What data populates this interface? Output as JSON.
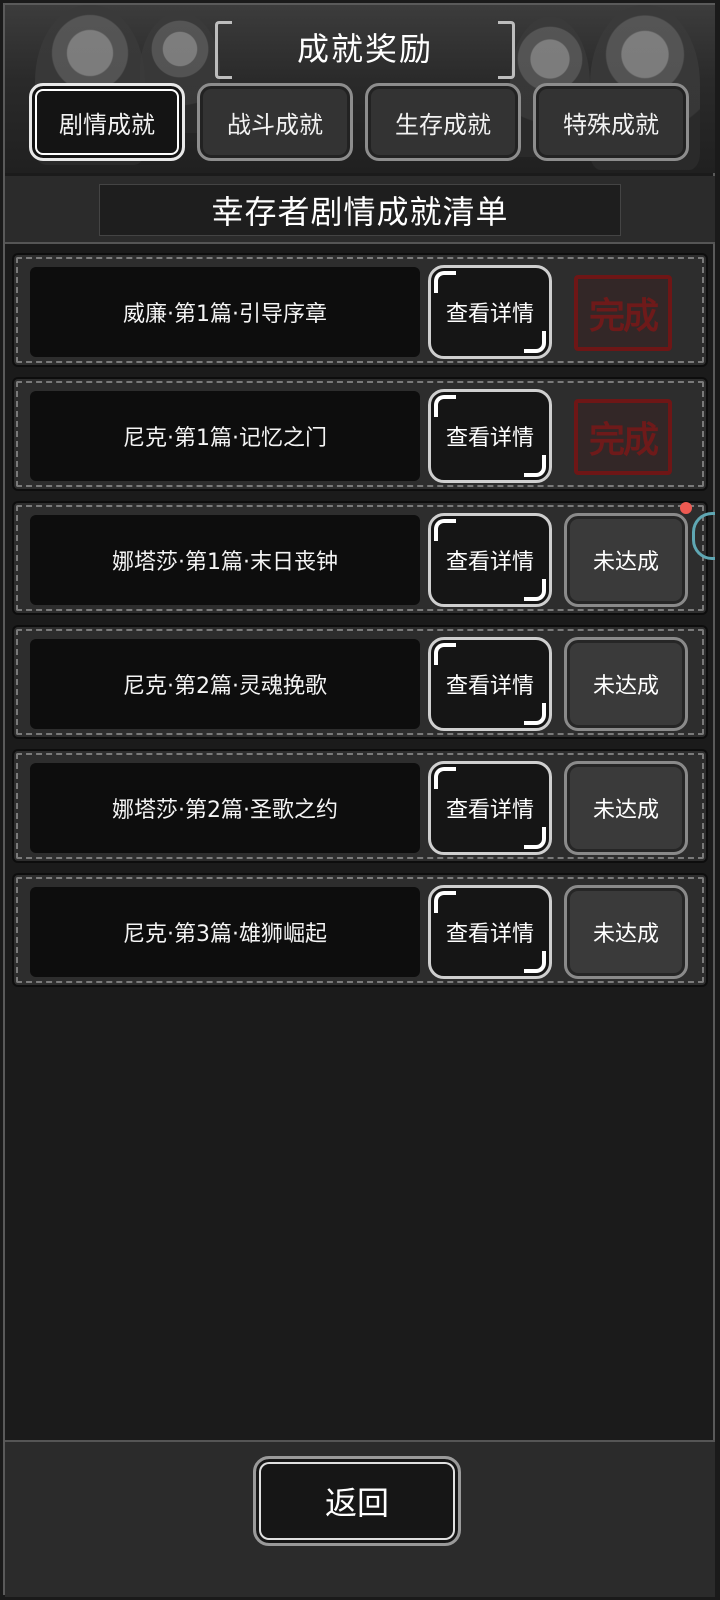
{
  "header": {
    "title": "成就奖励",
    "tabs": [
      {
        "label": "剧情成就",
        "active": true
      },
      {
        "label": "战斗成就",
        "active": false
      },
      {
        "label": "生存成就",
        "active": false
      },
      {
        "label": "特殊成就",
        "active": false
      }
    ]
  },
  "section": {
    "title": "幸存者剧情成就清单"
  },
  "achievements": [
    {
      "name": "威廉·第1篇·引导序章",
      "detail_label": "查看详情",
      "status": "完成",
      "completed": true
    },
    {
      "name": "尼克·第1篇·记忆之门",
      "detail_label": "查看详情",
      "status": "完成",
      "completed": true
    },
    {
      "name": "娜塔莎·第1篇·末日丧钟",
      "detail_label": "查看详情",
      "status": "未达成",
      "completed": false
    },
    {
      "name": "尼克·第2篇·灵魂挽歌",
      "detail_label": "查看详情",
      "status": "未达成",
      "completed": false
    },
    {
      "name": "娜塔莎·第2篇·圣歌之约",
      "detail_label": "查看详情",
      "status": "未达成",
      "completed": false
    },
    {
      "name": "尼克·第3篇·雄狮崛起",
      "detail_label": "查看详情",
      "status": "未达成",
      "completed": false
    }
  ],
  "footer": {
    "back_label": "返回"
  },
  "colors": {
    "background": "#1a1a1a",
    "stamp": "#6e1616",
    "notification_dot": "#ee5a52"
  }
}
